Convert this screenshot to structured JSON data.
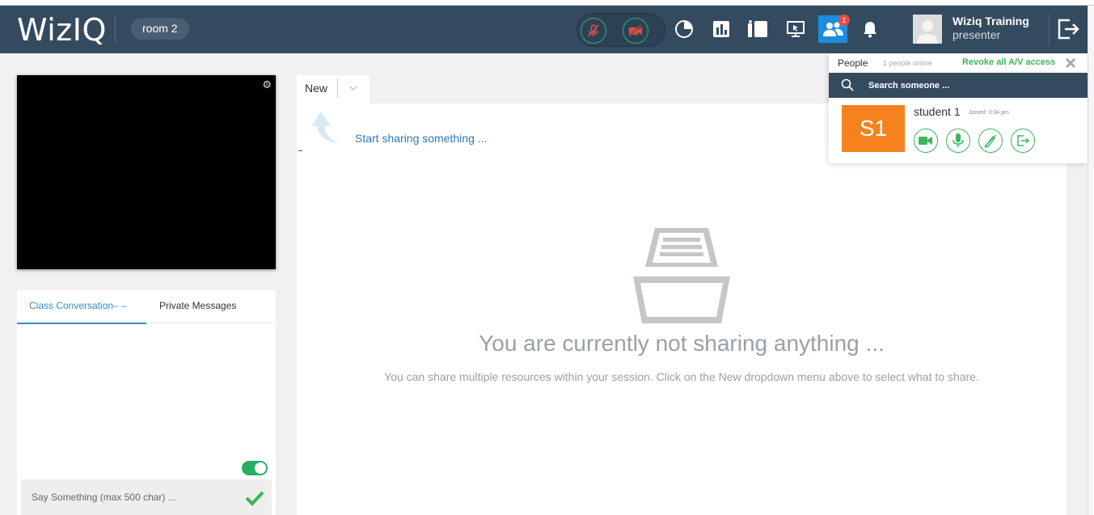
{
  "header": {
    "logo": "WizIQ",
    "room": "room 2",
    "notification_count": "1",
    "user": {
      "name": "Wiziq Training",
      "role": "presenter"
    }
  },
  "chat": {
    "tabs": [
      "Class Conversation– –",
      "Private Messages"
    ],
    "input_placeholder": "Say Something (max 500 char) ...",
    "toggle_on": true
  },
  "workspace": {
    "tab_label": "New",
    "start_hint": "Start sharing something ...",
    "empty_title": "You are currently not sharing anything ...",
    "empty_subtitle": "You can share multiple resources within your session. Click on the New dropdown menu above to select what to share."
  },
  "people": {
    "title": "People",
    "online": "1 people online",
    "revoke": "Revoke all A/V access",
    "search_placeholder": "Search someone ...",
    "students": [
      {
        "initials": "S1",
        "name": "student 1",
        "joined": "Joined: 3:34 pm"
      }
    ]
  },
  "colors": {
    "header_bg": "#344a5f",
    "accent_blue": "#2d8fcb",
    "green": "#3cb55b",
    "orange": "#f5821f",
    "muted_red": "#e74c3c"
  }
}
